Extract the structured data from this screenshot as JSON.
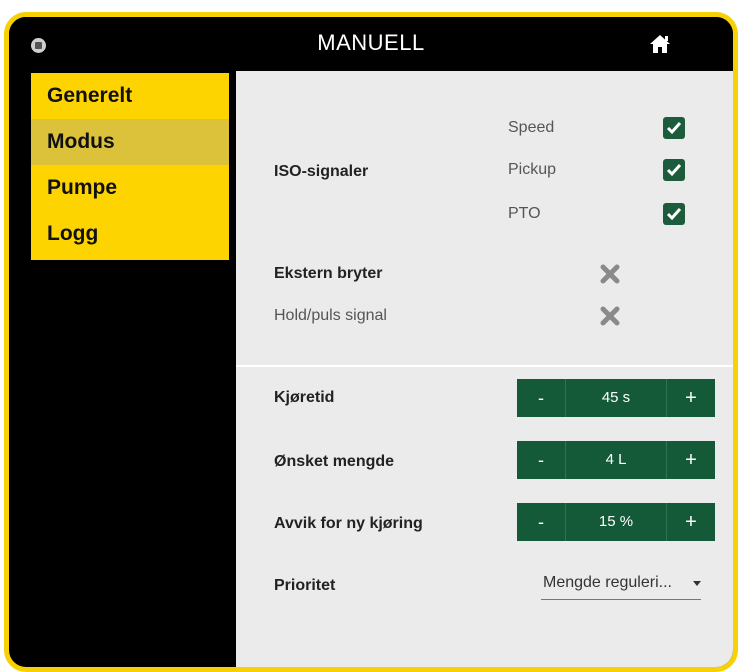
{
  "header": {
    "title": "MANUELL"
  },
  "sidebar": {
    "items": [
      {
        "label": "Generelt",
        "active": false
      },
      {
        "label": "Modus",
        "active": true
      },
      {
        "label": "Pumpe",
        "active": false
      },
      {
        "label": "Logg",
        "active": false
      }
    ]
  },
  "iso": {
    "label": "ISO-signaler",
    "signals": [
      {
        "label": "Speed",
        "checked": true
      },
      {
        "label": "Pickup",
        "checked": true
      },
      {
        "label": "PTO",
        "checked": true
      }
    ]
  },
  "switches": {
    "external": {
      "label": "Ekstern bryter",
      "enabled": false
    },
    "hold": {
      "label": "Hold/puls signal",
      "enabled": false
    }
  },
  "steppers": [
    {
      "label": "Kjøretid",
      "value": "45 s",
      "minus": "-",
      "plus": "+"
    },
    {
      "label": "Ønsket mengde",
      "value": "4 L",
      "minus": "-",
      "plus": "+"
    },
    {
      "label": "Avvik for ny kjøring",
      "value": "15 %",
      "minus": "-",
      "plus": "+"
    }
  ],
  "priority": {
    "label": "Prioritet",
    "value": "Mengde reguleri..."
  },
  "colors": {
    "accent_yellow": "#fed400",
    "button_green": "#155a38",
    "panel_bg": "#ebebeb"
  }
}
